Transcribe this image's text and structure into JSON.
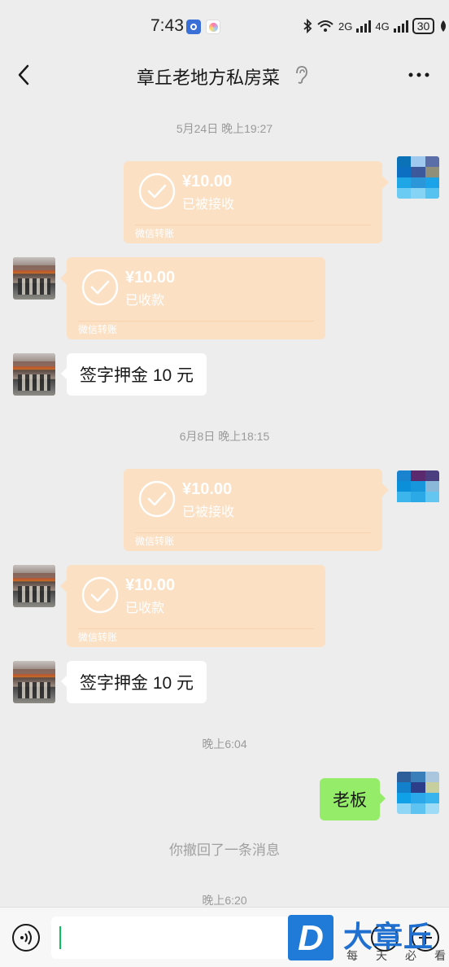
{
  "status_bar": {
    "time": "7:43",
    "network_1": "2G",
    "network_2": "4G",
    "battery": "30"
  },
  "header": {
    "title": "章丘老地方私房菜",
    "icons": [
      "back-icon",
      "ear-icon",
      "more-icon"
    ]
  },
  "messages": {
    "ts1": "5月24日 晚上19:27",
    "ts2": "6月8日 晚上18:15",
    "ts3": "晚上6:04",
    "ts4": "晚上6:20",
    "recalled": "你撤回了一条消息",
    "t1": {
      "amount": "¥10.00",
      "status": "已被接收",
      "footer": "微信转账"
    },
    "t2": {
      "amount": "¥10.00",
      "status": "已收款",
      "footer": "微信转账"
    },
    "m1": "签字押金 10 元",
    "t3": {
      "amount": "¥10.00",
      "status": "已被接收",
      "footer": "微信转账"
    },
    "t4": {
      "amount": "¥10.00",
      "status": "已收款",
      "footer": "微信转账"
    },
    "m2": "签字押金 10 元",
    "m3": "老板"
  },
  "input_bar": {
    "icons": [
      "voice-icon",
      "emoji-icon",
      "plus-icon"
    ]
  },
  "watermark": {
    "logo_letter": "D",
    "title": "大章丘",
    "sub": [
      "每",
      "天",
      "必",
      "看"
    ]
  },
  "colors": {
    "background": "#ededed",
    "transfer_card": "#fbe0c4",
    "my_bubble": "#95ec69",
    "accent": "#07c160",
    "watermark_blue": "#1f7ad8"
  }
}
